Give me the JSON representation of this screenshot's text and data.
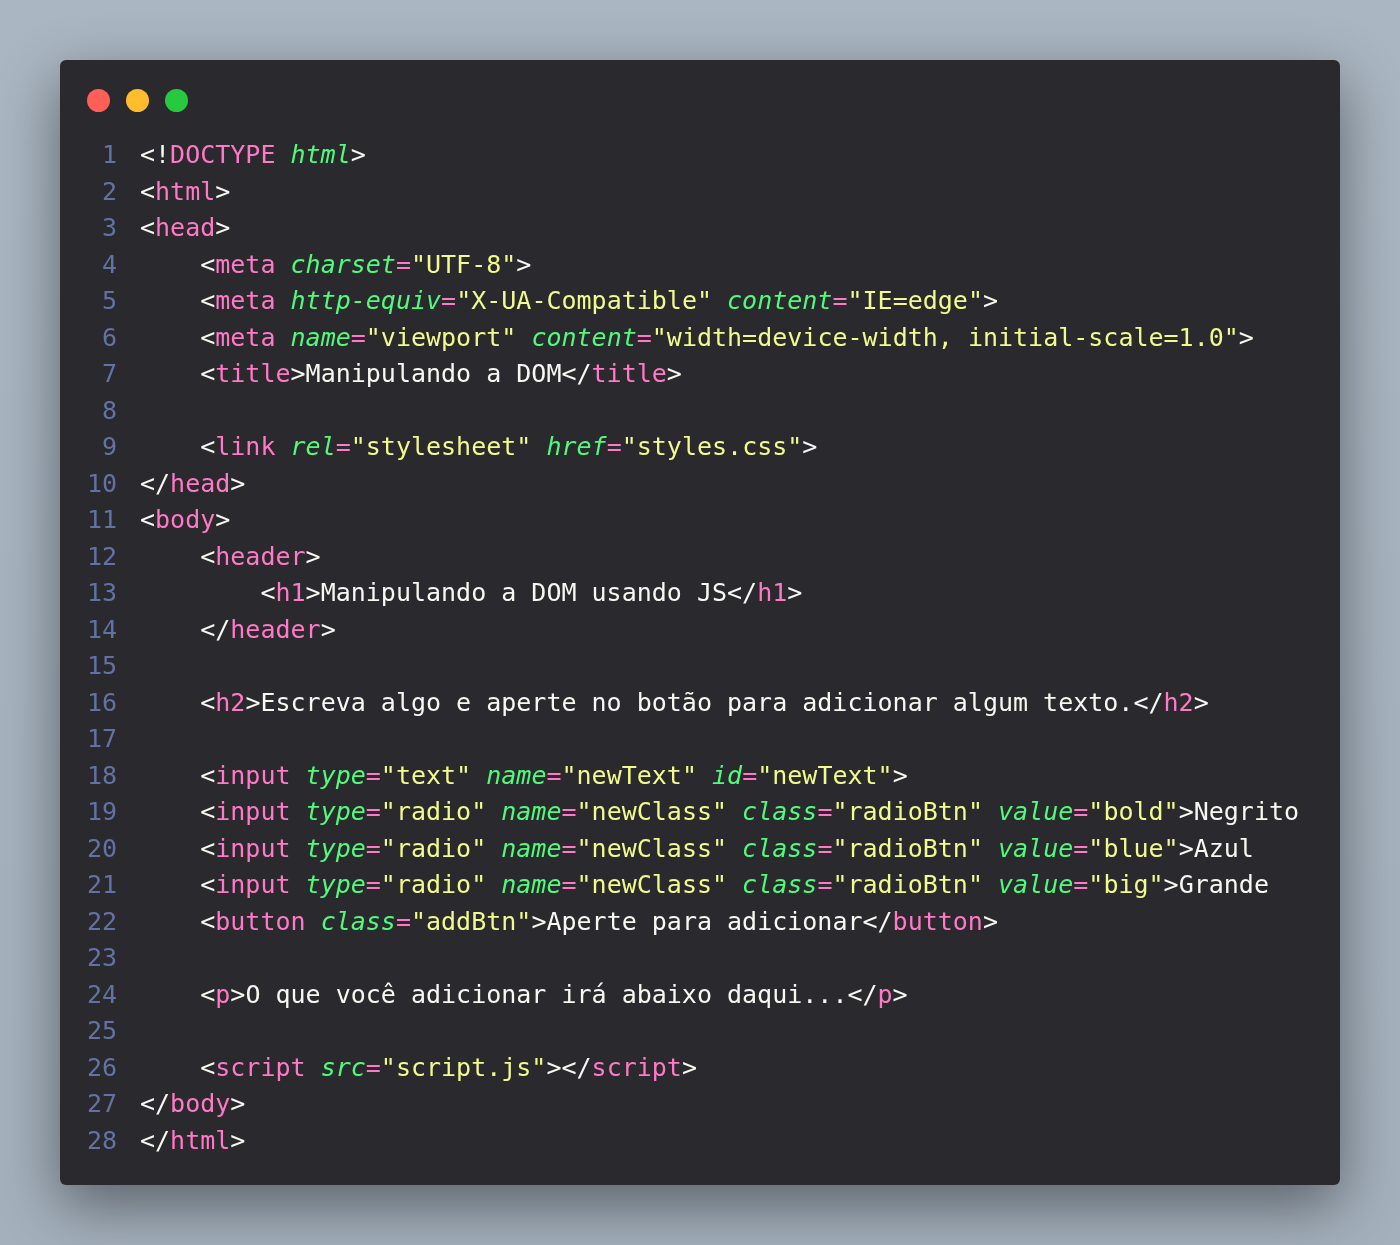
{
  "window": {
    "controls": [
      {
        "color": "#ff5f56"
      },
      {
        "color": "#ffbd2e"
      },
      {
        "color": "#27c93f"
      }
    ]
  },
  "code": {
    "lines": [
      {
        "number": "1",
        "tokens": [
          {
            "kind": "plain",
            "text": "<!"
          },
          {
            "kind": "tag",
            "text": "DOCTYPE"
          },
          {
            "kind": "attr",
            "text": " html"
          },
          {
            "kind": "plain",
            "text": ">"
          }
        ]
      },
      {
        "number": "2",
        "tokens": [
          {
            "kind": "plain",
            "text": "<"
          },
          {
            "kind": "tag",
            "text": "html"
          },
          {
            "kind": "plain",
            "text": ">"
          }
        ]
      },
      {
        "number": "3",
        "tokens": [
          {
            "kind": "plain",
            "text": "<"
          },
          {
            "kind": "tag",
            "text": "head"
          },
          {
            "kind": "plain",
            "text": ">"
          }
        ]
      },
      {
        "number": "4",
        "tokens": [
          {
            "kind": "plain",
            "text": "    <"
          },
          {
            "kind": "tag",
            "text": "meta"
          },
          {
            "kind": "attr",
            "text": " charset"
          },
          {
            "kind": "op",
            "text": "="
          },
          {
            "kind": "string",
            "text": "\"UTF-8\""
          },
          {
            "kind": "plain",
            "text": ">"
          }
        ]
      },
      {
        "number": "5",
        "tokens": [
          {
            "kind": "plain",
            "text": "    <"
          },
          {
            "kind": "tag",
            "text": "meta"
          },
          {
            "kind": "attr",
            "text": " http-equiv"
          },
          {
            "kind": "op",
            "text": "="
          },
          {
            "kind": "string",
            "text": "\"X-UA-Compatible\""
          },
          {
            "kind": "attr",
            "text": " content"
          },
          {
            "kind": "op",
            "text": "="
          },
          {
            "kind": "string",
            "text": "\"IE=edge\""
          },
          {
            "kind": "plain",
            "text": ">"
          }
        ]
      },
      {
        "number": "6",
        "tokens": [
          {
            "kind": "plain",
            "text": "    <"
          },
          {
            "kind": "tag",
            "text": "meta"
          },
          {
            "kind": "attr",
            "text": " name"
          },
          {
            "kind": "op",
            "text": "="
          },
          {
            "kind": "string",
            "text": "\"viewport\""
          },
          {
            "kind": "attr",
            "text": " content"
          },
          {
            "kind": "op",
            "text": "="
          },
          {
            "kind": "string",
            "text": "\"width=device-width, initial-scale=1.0\""
          },
          {
            "kind": "plain",
            "text": ">"
          }
        ]
      },
      {
        "number": "7",
        "tokens": [
          {
            "kind": "plain",
            "text": "    <"
          },
          {
            "kind": "tag",
            "text": "title"
          },
          {
            "kind": "plain",
            "text": ">Manipulando a DOM</"
          },
          {
            "kind": "tag",
            "text": "title"
          },
          {
            "kind": "plain",
            "text": ">"
          }
        ]
      },
      {
        "number": "8"
      },
      {
        "number": "9",
        "tokens": [
          {
            "kind": "plain",
            "text": "    <"
          },
          {
            "kind": "tag",
            "text": "link"
          },
          {
            "kind": "attr",
            "text": " rel"
          },
          {
            "kind": "op",
            "text": "="
          },
          {
            "kind": "string",
            "text": "\"stylesheet\""
          },
          {
            "kind": "attr",
            "text": " href"
          },
          {
            "kind": "op",
            "text": "="
          },
          {
            "kind": "string",
            "text": "\"styles.css\""
          },
          {
            "kind": "plain",
            "text": ">"
          }
        ]
      },
      {
        "number": "10",
        "tokens": [
          {
            "kind": "plain",
            "text": "</"
          },
          {
            "kind": "tag",
            "text": "head"
          },
          {
            "kind": "plain",
            "text": ">"
          }
        ]
      },
      {
        "number": "11",
        "tokens": [
          {
            "kind": "plain",
            "text": "<"
          },
          {
            "kind": "tag",
            "text": "body"
          },
          {
            "kind": "plain",
            "text": ">"
          }
        ]
      },
      {
        "number": "12",
        "tokens": [
          {
            "kind": "plain",
            "text": "    <"
          },
          {
            "kind": "tag",
            "text": "header"
          },
          {
            "kind": "plain",
            "text": ">"
          }
        ]
      },
      {
        "number": "13",
        "tokens": [
          {
            "kind": "plain",
            "text": "        <"
          },
          {
            "kind": "tag",
            "text": "h1"
          },
          {
            "kind": "plain",
            "text": ">Manipulando a DOM usando JS</"
          },
          {
            "kind": "tag",
            "text": "h1"
          },
          {
            "kind": "plain",
            "text": ">"
          }
        ]
      },
      {
        "number": "14",
        "tokens": [
          {
            "kind": "plain",
            "text": "    </"
          },
          {
            "kind": "tag",
            "text": "header"
          },
          {
            "kind": "plain",
            "text": ">"
          }
        ]
      },
      {
        "number": "15"
      },
      {
        "number": "16",
        "tokens": [
          {
            "kind": "plain",
            "text": "    <"
          },
          {
            "kind": "tag",
            "text": "h2"
          },
          {
            "kind": "plain",
            "text": ">Escreva algo e aperte no botão para adicionar algum texto.</"
          },
          {
            "kind": "tag",
            "text": "h2"
          },
          {
            "kind": "plain",
            "text": ">"
          }
        ]
      },
      {
        "number": "17"
      },
      {
        "number": "18",
        "tokens": [
          {
            "kind": "plain",
            "text": "    <"
          },
          {
            "kind": "tag",
            "text": "input"
          },
          {
            "kind": "attr",
            "text": " type"
          },
          {
            "kind": "op",
            "text": "="
          },
          {
            "kind": "string",
            "text": "\"text\""
          },
          {
            "kind": "attr",
            "text": " name"
          },
          {
            "kind": "op",
            "text": "="
          },
          {
            "kind": "string",
            "text": "\"newText\""
          },
          {
            "kind": "attr",
            "text": " id"
          },
          {
            "kind": "op",
            "text": "="
          },
          {
            "kind": "string",
            "text": "\"newText\""
          },
          {
            "kind": "plain",
            "text": ">"
          }
        ]
      },
      {
        "number": "19",
        "tokens": [
          {
            "kind": "plain",
            "text": "    <"
          },
          {
            "kind": "tag",
            "text": "input"
          },
          {
            "kind": "attr",
            "text": " type"
          },
          {
            "kind": "op",
            "text": "="
          },
          {
            "kind": "string",
            "text": "\"radio\""
          },
          {
            "kind": "attr",
            "text": " name"
          },
          {
            "kind": "op",
            "text": "="
          },
          {
            "kind": "string",
            "text": "\"newClass\""
          },
          {
            "kind": "attr",
            "text": " class"
          },
          {
            "kind": "op",
            "text": "="
          },
          {
            "kind": "string",
            "text": "\"radioBtn\""
          },
          {
            "kind": "attr",
            "text": " value"
          },
          {
            "kind": "op",
            "text": "="
          },
          {
            "kind": "string",
            "text": "\"bold\""
          },
          {
            "kind": "plain",
            "text": ">Negrito"
          }
        ]
      },
      {
        "number": "20",
        "tokens": [
          {
            "kind": "plain",
            "text": "    <"
          },
          {
            "kind": "tag",
            "text": "input"
          },
          {
            "kind": "attr",
            "text": " type"
          },
          {
            "kind": "op",
            "text": "="
          },
          {
            "kind": "string",
            "text": "\"radio\""
          },
          {
            "kind": "attr",
            "text": " name"
          },
          {
            "kind": "op",
            "text": "="
          },
          {
            "kind": "string",
            "text": "\"newClass\""
          },
          {
            "kind": "attr",
            "text": " class"
          },
          {
            "kind": "op",
            "text": "="
          },
          {
            "kind": "string",
            "text": "\"radioBtn\""
          },
          {
            "kind": "attr",
            "text": " value"
          },
          {
            "kind": "op",
            "text": "="
          },
          {
            "kind": "string",
            "text": "\"blue\""
          },
          {
            "kind": "plain",
            "text": ">Azul"
          }
        ]
      },
      {
        "number": "21",
        "tokens": [
          {
            "kind": "plain",
            "text": "    <"
          },
          {
            "kind": "tag",
            "text": "input"
          },
          {
            "kind": "attr",
            "text": " type"
          },
          {
            "kind": "op",
            "text": "="
          },
          {
            "kind": "string",
            "text": "\"radio\""
          },
          {
            "kind": "attr",
            "text": " name"
          },
          {
            "kind": "op",
            "text": "="
          },
          {
            "kind": "string",
            "text": "\"newClass\""
          },
          {
            "kind": "attr",
            "text": " class"
          },
          {
            "kind": "op",
            "text": "="
          },
          {
            "kind": "string",
            "text": "\"radioBtn\""
          },
          {
            "kind": "attr",
            "text": " value"
          },
          {
            "kind": "op",
            "text": "="
          },
          {
            "kind": "string",
            "text": "\"big\""
          },
          {
            "kind": "plain",
            "text": ">Grande"
          }
        ]
      },
      {
        "number": "22",
        "tokens": [
          {
            "kind": "plain",
            "text": "    <"
          },
          {
            "kind": "tag",
            "text": "button"
          },
          {
            "kind": "attr",
            "text": " class"
          },
          {
            "kind": "op",
            "text": "="
          },
          {
            "kind": "string",
            "text": "\"addBtn\""
          },
          {
            "kind": "plain",
            "text": ">Aperte para adicionar</"
          },
          {
            "kind": "tag",
            "text": "button"
          },
          {
            "kind": "plain",
            "text": ">"
          }
        ]
      },
      {
        "number": "23"
      },
      {
        "number": "24",
        "tokens": [
          {
            "kind": "plain",
            "text": "    <"
          },
          {
            "kind": "tag",
            "text": "p"
          },
          {
            "kind": "plain",
            "text": ">O que você adicionar irá abaixo daqui...</"
          },
          {
            "kind": "tag",
            "text": "p"
          },
          {
            "kind": "plain",
            "text": ">"
          }
        ]
      },
      {
        "number": "25"
      },
      {
        "number": "26",
        "tokens": [
          {
            "kind": "plain",
            "text": "    <"
          },
          {
            "kind": "tag",
            "text": "script"
          },
          {
            "kind": "attr",
            "text": " src"
          },
          {
            "kind": "op",
            "text": "="
          },
          {
            "kind": "string",
            "text": "\"script.js\""
          },
          {
            "kind": "plain",
            "text": "></"
          },
          {
            "kind": "tag",
            "text": "script"
          },
          {
            "kind": "plain",
            "text": ">"
          }
        ]
      },
      {
        "number": "27",
        "tokens": [
          {
            "kind": "plain",
            "text": "</"
          },
          {
            "kind": "tag",
            "text": "body"
          },
          {
            "kind": "plain",
            "text": ">"
          }
        ]
      },
      {
        "number": "28",
        "tokens": [
          {
            "kind": "plain",
            "text": "</"
          },
          {
            "kind": "tag",
            "text": "html"
          },
          {
            "kind": "plain",
            "text": ">"
          }
        ]
      }
    ]
  }
}
